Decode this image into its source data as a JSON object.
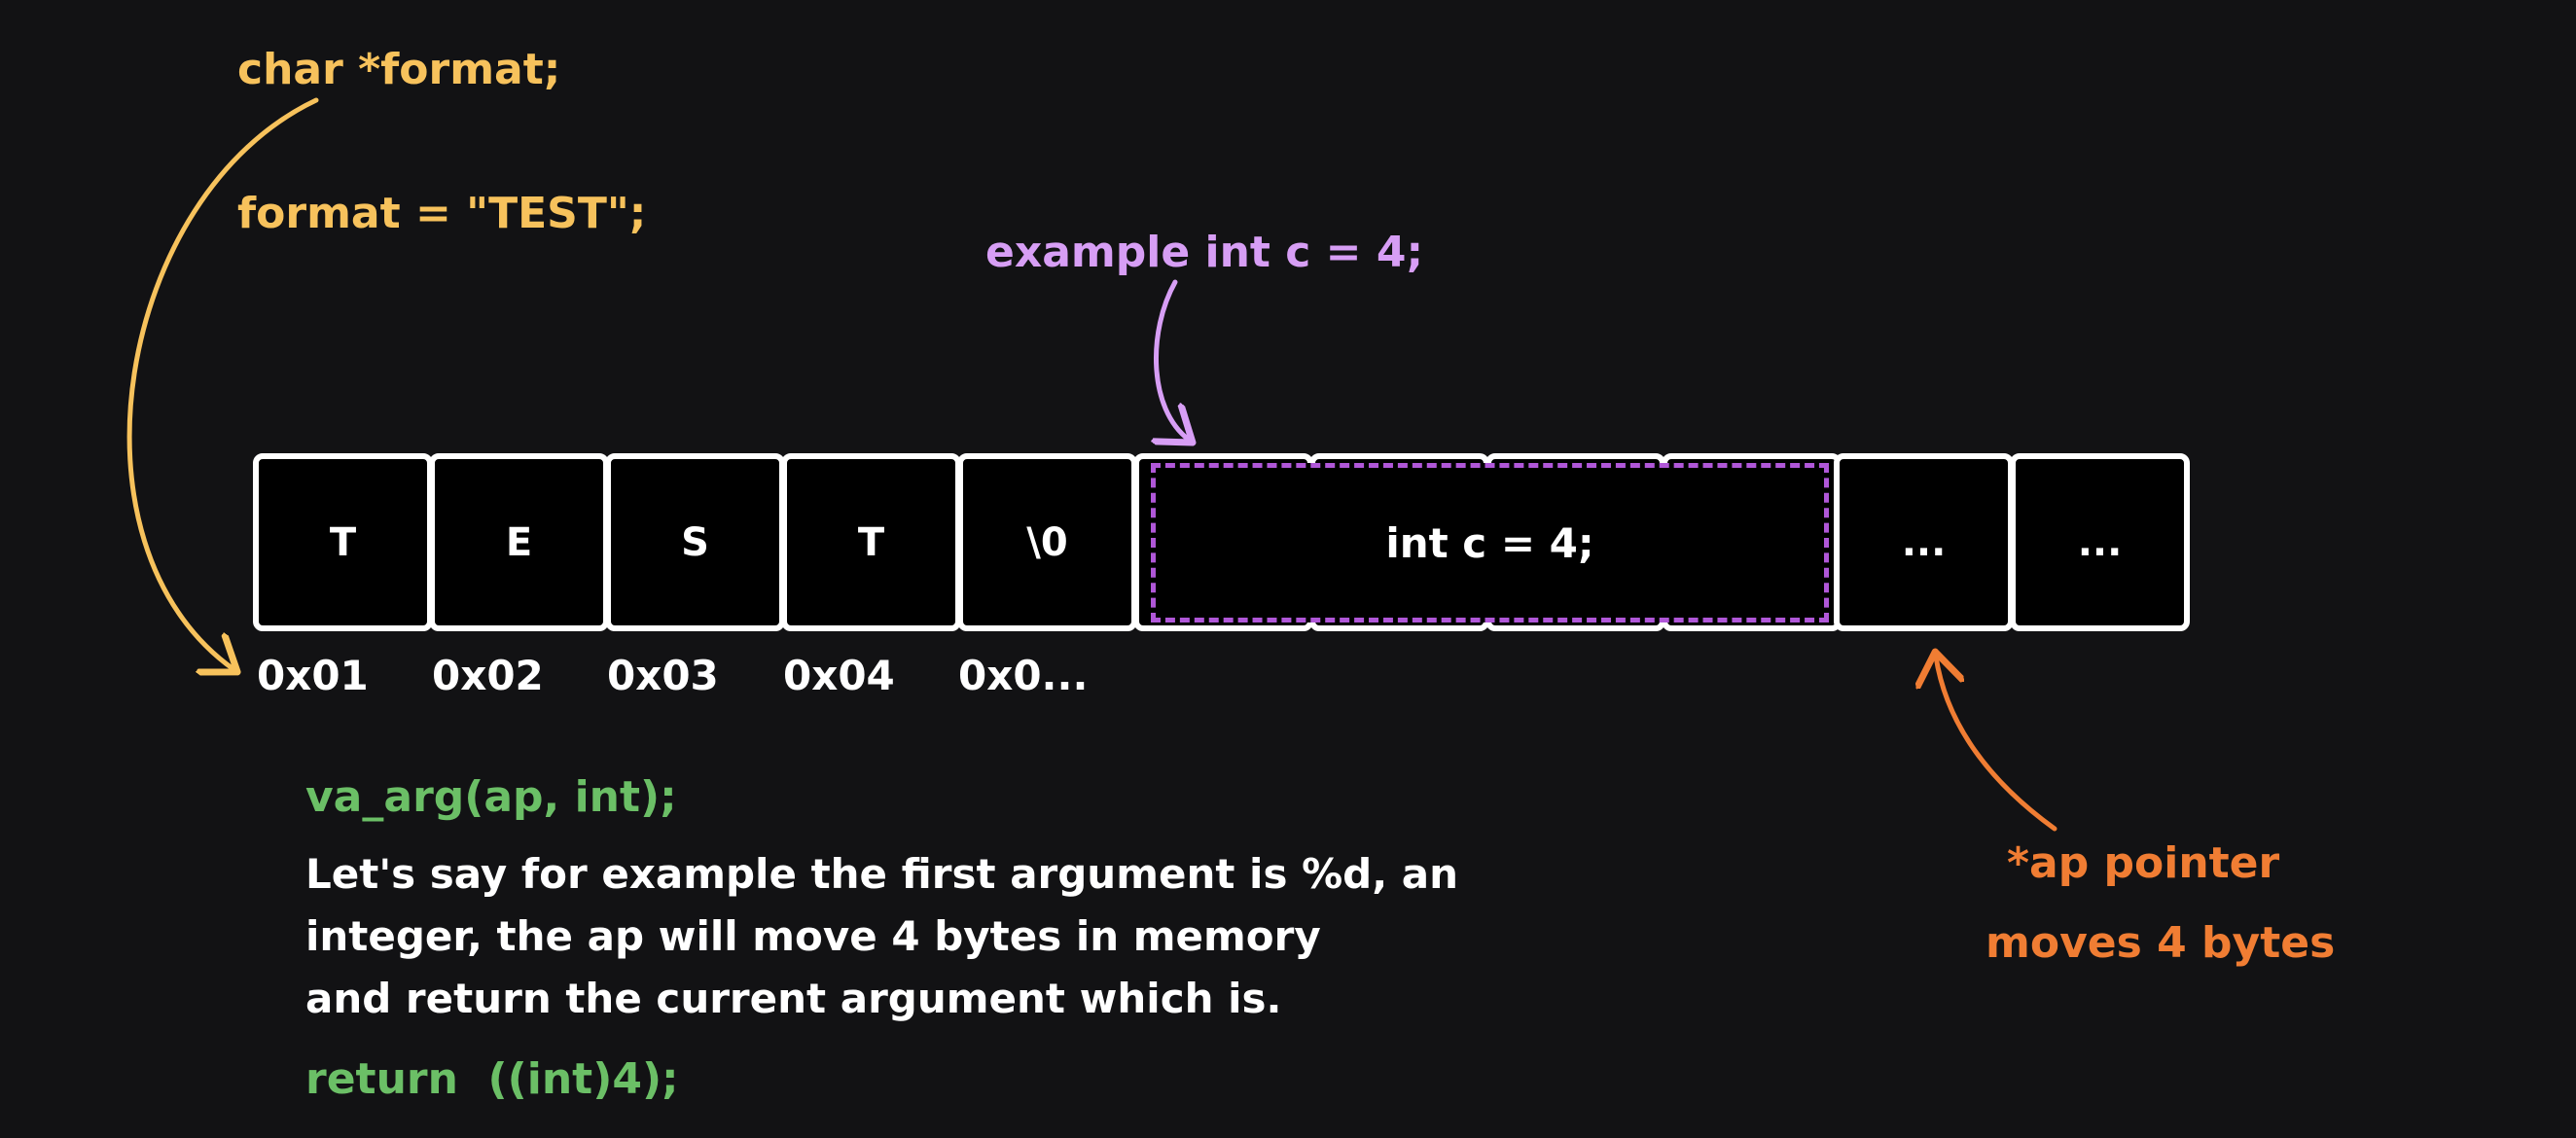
{
  "labels": {
    "char_decl": "char *format;",
    "format_assign": "format = \"TEST\";",
    "example_int": "example int c = 4;",
    "va_arg_call": "va_arg(ap, int);",
    "explanation_lines": [
      "Let's say for example the first argument is %d, an",
      "integer, the ap will move 4 bytes in memory",
      "and return the current argument which is."
    ],
    "return_stmt": "return  ((int)4);",
    "ap_pointer": "*ap pointer",
    "moves_bytes": "moves 4 bytes"
  },
  "memory": {
    "cells": [
      "T",
      "E",
      "S",
      "T",
      "\\0",
      "",
      "",
      "",
      "",
      "...",
      "..."
    ],
    "int_block_label": "int c = 4;",
    "addresses": [
      "0x01",
      "0x02",
      "0x03",
      "0x04",
      "0x0..."
    ]
  },
  "colors": {
    "background": "#121214",
    "yellow": "#f7c25c",
    "purple": "#d79ef5",
    "purple_dashed": "#b057d8",
    "green": "#6bbf66",
    "orange": "#f07d33",
    "cell_border": "#ffffff"
  }
}
